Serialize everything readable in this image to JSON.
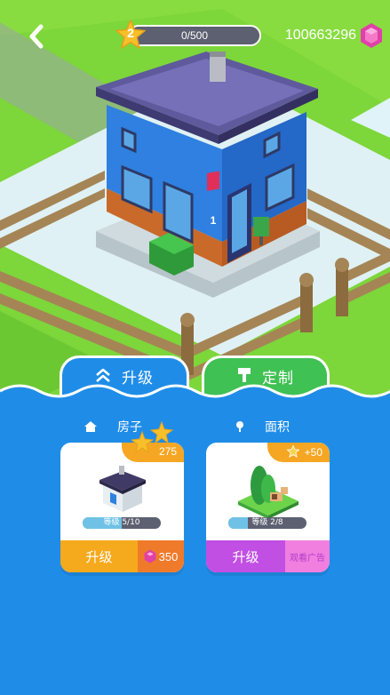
{
  "hud": {
    "level": "2",
    "xp_text": "0/500",
    "xp_progress": 0.0,
    "gems": "100663296"
  },
  "tabs": [
    {
      "label": "升级",
      "icon": "double-chevron-up-icon",
      "active": true
    },
    {
      "label": "定制",
      "icon": "paint-roller-icon",
      "active": false
    }
  ],
  "sections": [
    {
      "title": "房子",
      "icon": "home-icon"
    },
    {
      "title": "面积",
      "icon": "pin-icon"
    }
  ],
  "cards": {
    "house": {
      "badge": "275",
      "level_text": "等级 5/10",
      "level_progress": 0.5,
      "button_label": "升级",
      "cost": "350"
    },
    "area": {
      "badge": "+50",
      "level_text": "等级 2/8",
      "level_progress": 0.25,
      "button_label": "升级",
      "ad_label": "观看广告"
    }
  },
  "house": {
    "sign_number": "1"
  },
  "colors": {
    "water": "#1f8de8",
    "grass": "#3fc153",
    "orange": "#f5a91c",
    "purple": "#c14fe3",
    "gem": "#e040a8"
  }
}
